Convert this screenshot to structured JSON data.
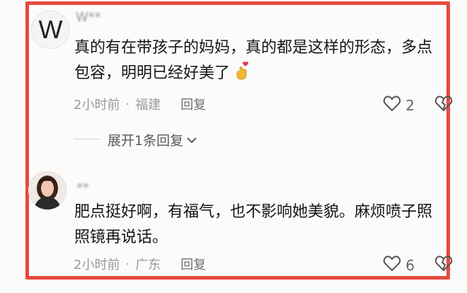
{
  "comments": [
    {
      "avatar_letter": "W",
      "username": "W**",
      "text": "真的有在带孩子的妈妈，真的都是这样的形态，多点包容，明明已经好美了",
      "time": "2小时前",
      "location": "福建",
      "reply_label": "回复",
      "like_count": "2",
      "expand_replies": "展开1条回复"
    },
    {
      "username": "**",
      "text": "肥点挺好啊，有福气，也不影响她美貌。麻烦喷子照照镜再说话。",
      "time": "2小时前",
      "location": "广东",
      "reply_label": "回复",
      "like_count": "6"
    }
  ],
  "meta": {
    "separator": "·"
  },
  "icons": {
    "like": "heart-outline-icon",
    "dislike": "broken-heart-icon",
    "expand": "chevron-down-icon",
    "emoji": "crossed-fingers-heart-emoji"
  },
  "colors": {
    "frame": "#e64a3e",
    "text": "#151515",
    "meta": "#9a9a9a"
  }
}
